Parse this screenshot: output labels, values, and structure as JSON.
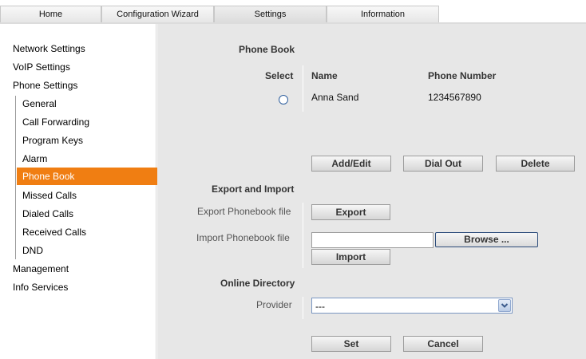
{
  "tabs": [
    {
      "label": "Home"
    },
    {
      "label": "Configuration Wizard"
    },
    {
      "label": "Settings"
    },
    {
      "label": "Information"
    }
  ],
  "sidebar": {
    "items": [
      {
        "label": "Network Settings"
      },
      {
        "label": "VoIP Settings"
      },
      {
        "label": "Phone Settings"
      },
      {
        "label": "General"
      },
      {
        "label": "Call Forwarding"
      },
      {
        "label": "Program Keys"
      },
      {
        "label": "Alarm"
      },
      {
        "label": "Phone Book"
      },
      {
        "label": "Missed Calls"
      },
      {
        "label": "Dialed Calls"
      },
      {
        "label": "Received Calls"
      },
      {
        "label": "DND"
      },
      {
        "label": "Management"
      },
      {
        "label": "Info Services"
      }
    ],
    "active": "Phone Book",
    "accent_color": "#f07e12"
  },
  "phonebook": {
    "title": "Phone Book",
    "col_select": "Select",
    "col_name": "Name",
    "col_number": "Phone Number",
    "entries": [
      {
        "name": "Anna Sand",
        "number": "1234567890"
      }
    ],
    "btn_add_edit": "Add/Edit",
    "btn_dial_out": "Dial Out",
    "btn_delete": "Delete"
  },
  "export_import": {
    "title": "Export and Import",
    "export_label": "Export Phonebook file",
    "export_btn": "Export",
    "import_label": "Import Phonebook file",
    "file_value": "",
    "browse_btn": "Browse ...",
    "import_btn": "Import"
  },
  "online_directory": {
    "title": "Online Directory",
    "provider_label": "Provider",
    "provider_value": "---"
  },
  "footer": {
    "set_btn": "Set",
    "cancel_btn": "Cancel"
  }
}
